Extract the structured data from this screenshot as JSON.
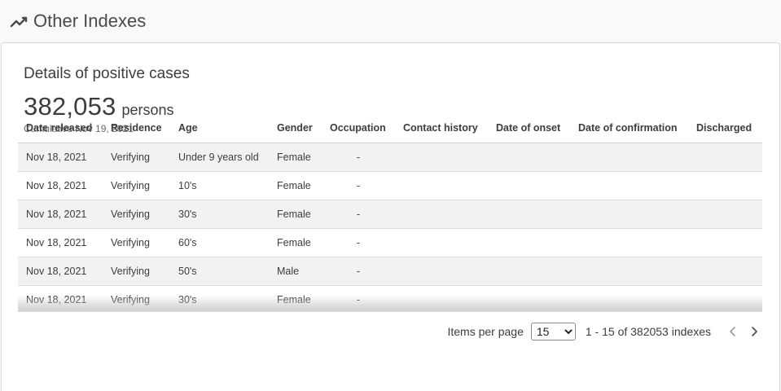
{
  "header": {
    "title": "Other Indexes",
    "icon": "trending-line-icon"
  },
  "card": {
    "title": "Details of positive cases",
    "total": "382,053",
    "unit": "persons",
    "subtext": "Cumulative Nov 19, 2021"
  },
  "table": {
    "columns": [
      "Date released",
      "Residence",
      "Age",
      "Gender",
      "Occupation",
      "Contact history",
      "Date of onset",
      "Date of confirmation",
      "Discharged"
    ],
    "rows": [
      [
        "Nov 18, 2021",
        "Verifying",
        "Under 9 years old",
        "Female",
        "-",
        "",
        "",
        "",
        ""
      ],
      [
        "Nov 18, 2021",
        "Verifying",
        "10's",
        "Female",
        "-",
        "",
        "",
        "",
        ""
      ],
      [
        "Nov 18, 2021",
        "Verifying",
        "30's",
        "Female",
        "-",
        "",
        "",
        "",
        ""
      ],
      [
        "Nov 18, 2021",
        "Verifying",
        "60's",
        "Female",
        "-",
        "",
        "",
        "",
        ""
      ],
      [
        "Nov 18, 2021",
        "Verifying",
        "50's",
        "Male",
        "-",
        "",
        "",
        "",
        ""
      ],
      [
        "Nov 18, 2021",
        "Verifying",
        "30's",
        "Female",
        "-",
        "",
        "",
        "",
        ""
      ]
    ]
  },
  "pagination": {
    "items_label": "Items per page",
    "page_size": "15",
    "range_text": "1 - 15 of 382053 indexes"
  }
}
